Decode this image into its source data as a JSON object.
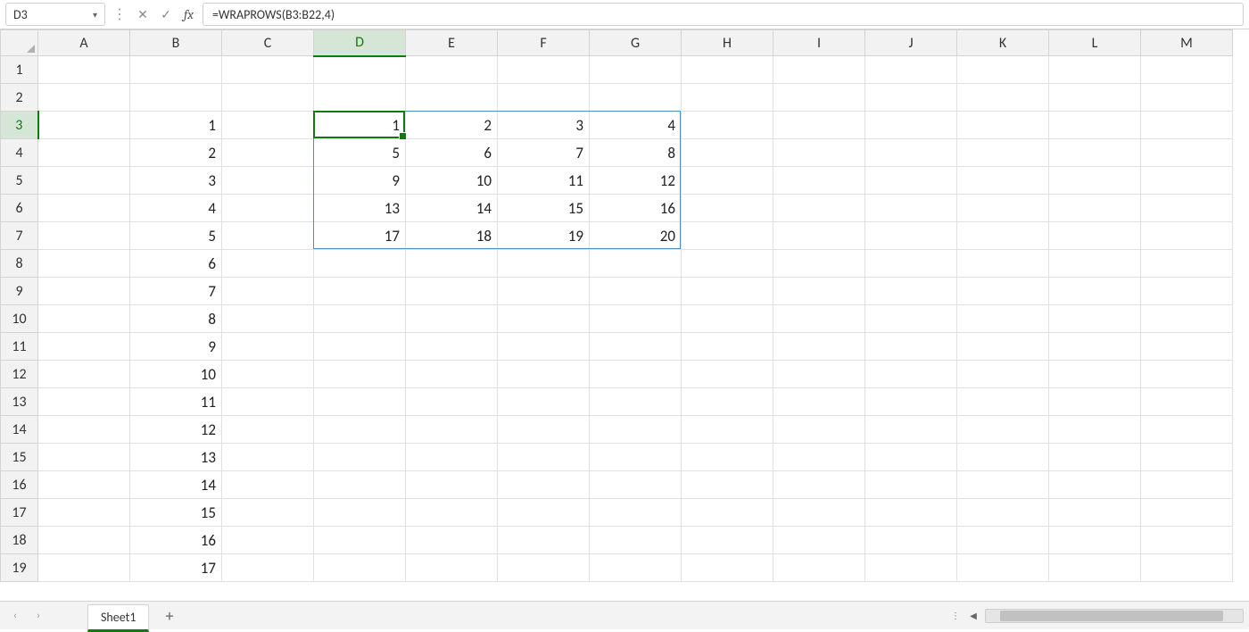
{
  "name_box": "D3",
  "formula": "=WRAPROWS(B3:B22,4)",
  "col_headers": [
    "A",
    "B",
    "C",
    "D",
    "E",
    "F",
    "G",
    "H",
    "I",
    "J",
    "K",
    "L",
    "M"
  ],
  "row_headers": [
    "1",
    "2",
    "3",
    "4",
    "5",
    "6",
    "7",
    "8",
    "9",
    "10",
    "11",
    "12",
    "13",
    "14",
    "15",
    "16",
    "17",
    "18",
    "19"
  ],
  "active_cell": {
    "col": 3,
    "row": 2
  },
  "selected_col_index": 3,
  "selected_row_index": 2,
  "spill_range": {
    "col_start": 3,
    "col_end": 6,
    "row_start": 2,
    "row_end": 6
  },
  "cells": {
    "B3": "1",
    "B4": "2",
    "B5": "3",
    "B6": "4",
    "B7": "5",
    "B8": "6",
    "B9": "7",
    "B10": "8",
    "B11": "9",
    "B12": "10",
    "B13": "11",
    "B14": "12",
    "B15": "13",
    "B16": "14",
    "B17": "15",
    "B18": "16",
    "B19": "17",
    "D3": "1",
    "E3": "2",
    "F3": "3",
    "G3": "4",
    "D4": "5",
    "E4": "6",
    "F4": "7",
    "G4": "8",
    "D5": "9",
    "E5": "10",
    "F5": "11",
    "G5": "12",
    "D6": "13",
    "E6": "14",
    "F6": "15",
    "G6": "16",
    "D7": "17",
    "E7": "18",
    "F7": "19",
    "G7": "20"
  },
  "sheet_tab": "Sheet1",
  "icons": {
    "cancel": "✕",
    "enter": "✓",
    "fx": "fx",
    "chev": "▾",
    "nav_prev": "‹",
    "nav_next": "›",
    "add": "+",
    "vdots": "⋮",
    "tri_left": "◀"
  }
}
